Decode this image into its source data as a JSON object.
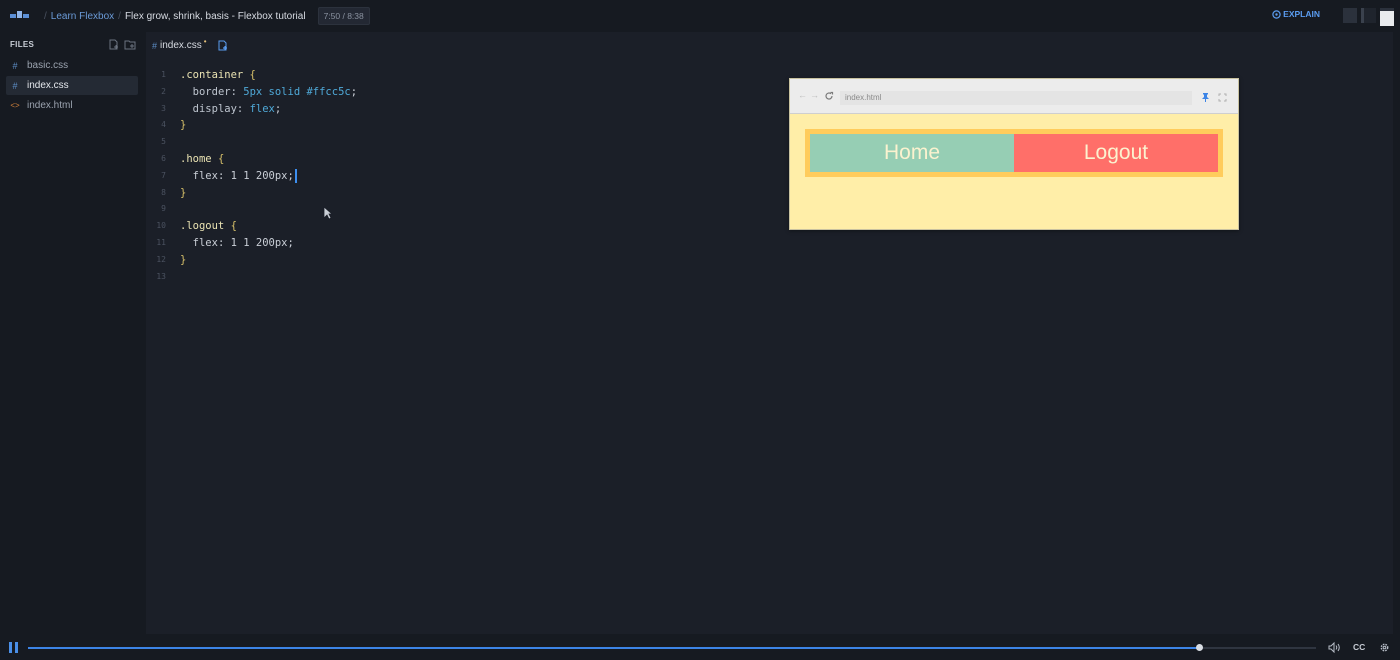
{
  "breadcrumb": {
    "course": "Learn Flexbox",
    "lesson": "Flex grow, shrink, basis - Flexbox tutorial",
    "time": "7:50 / 8:38"
  },
  "topbar": {
    "explain_label": "EXPLAIN"
  },
  "sidebar": {
    "heading": "FILES",
    "files": [
      {
        "name": "basic.css",
        "icon": "hash-icon",
        "active": false
      },
      {
        "name": "index.css",
        "icon": "hash-icon",
        "active": true
      },
      {
        "name": "index.html",
        "icon": "html-tag-icon",
        "active": false
      }
    ]
  },
  "editor": {
    "tab_name": "index.css",
    "modified_marker": "•",
    "line_numbers": [
      "1",
      "2",
      "3",
      "4",
      "5",
      "6",
      "7",
      "8",
      "9",
      "10",
      "11",
      "12",
      "13"
    ],
    "lines": {
      "l1_selector": ".container",
      "l2_prop": "border:",
      "l2_val": "5px solid #ffcc5c",
      "l3_prop": "display:",
      "l3_val": "flex",
      "l6_selector": ".home",
      "l7_text": "flex: 1 1 200px;",
      "l10_selector": ".logout",
      "l11_text": "flex: 1 1 200px;",
      "open_brace": "{",
      "close_brace": "}",
      "semicolon": ";"
    }
  },
  "preview": {
    "address": "index.html",
    "nav_home": "Home",
    "nav_logout": "Logout"
  },
  "player": {
    "cc_label": "CC",
    "progress": 0.909
  },
  "colors": {
    "accent": "#3c84e6",
    "home_bg": "#96ceb4",
    "logout_bg": "#ff6f69",
    "container_border": "#ffcc5c",
    "preview_bg": "#ffeea8"
  }
}
